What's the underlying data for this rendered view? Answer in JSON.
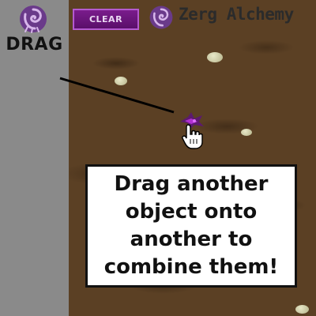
{
  "sidebar": {
    "drag_label": "DRAG",
    "logo_icon": "zerg-swirl-icon"
  },
  "toolbar": {
    "clear_label": "CLEAR"
  },
  "header": {
    "title": "Zerg Alchemy",
    "logo_icon": "zerg-swirl-icon"
  },
  "playfield": {
    "element_icon": "zerg-element-icon",
    "cursor_icon": "hand-pointer-icon"
  },
  "tutorial": {
    "text": "Drag another\nobject onto\nanother to\ncombine them!"
  },
  "colors": {
    "sidebar": "#8a8a8a",
    "ground": "#5b4024",
    "clear_button": "#6a1580",
    "accent": "#b45ad0"
  }
}
